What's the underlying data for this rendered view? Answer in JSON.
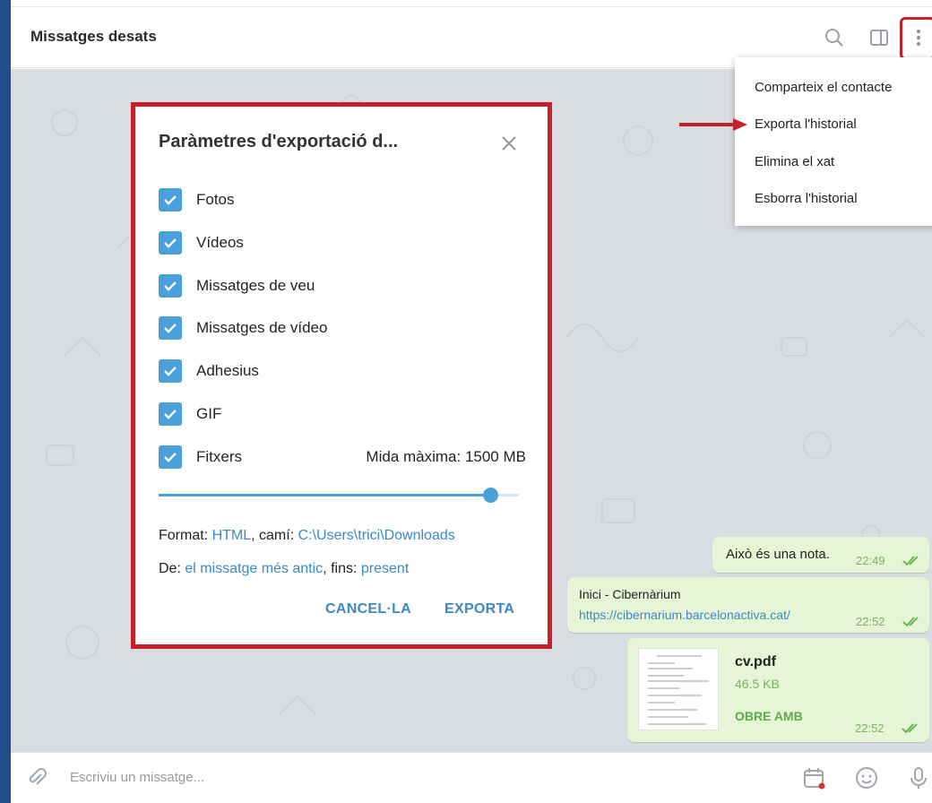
{
  "header": {
    "title": "Missatges desats",
    "icons": [
      "search-icon",
      "sidebar-toggle-icon",
      "more-vertical-icon"
    ]
  },
  "menu": {
    "items": [
      {
        "label": "Comparteix el contacte"
      },
      {
        "label": "Exporta l'historial"
      },
      {
        "label": "Elimina el xat"
      },
      {
        "label": "Esborra l'historial"
      }
    ]
  },
  "dialog": {
    "title": "Paràmetres d'exportació d...",
    "options": [
      {
        "label": "Fotos",
        "checked": true
      },
      {
        "label": "Vídeos",
        "checked": true
      },
      {
        "label": "Missatges de veu",
        "checked": true
      },
      {
        "label": "Missatges de vídeo",
        "checked": true
      },
      {
        "label": "Adhesius",
        "checked": true
      },
      {
        "label": "GIF",
        "checked": true
      },
      {
        "label": "Fitxers",
        "checked": true
      }
    ],
    "max_size_label": "Mida màxima: 1500 MB",
    "slider_fraction": 0.92,
    "format_prefix": "Format: ",
    "format_value": "HTML",
    "path_prefix": ", camí: ",
    "path_value": "C:\\Users\\trici\\Downloads",
    "from_prefix": "De: ",
    "from_value": "el missatge més antic",
    "to_prefix": ", fins: ",
    "to_value": "present",
    "cancel_label": "CANCEL·LA",
    "export_label": "EXPORTA"
  },
  "messages": [
    {
      "text": "Això és una nota.",
      "time": "22:49"
    },
    {
      "title": "Inici - Cibernàrium",
      "link": "https://cibernarium.barcelonactiva.cat/",
      "time": "22:52"
    },
    {
      "file_name": "cv.pdf",
      "file_size": "46.5 KB",
      "action": "OBRE AMB",
      "time": "22:52"
    }
  ],
  "composer": {
    "placeholder": "Escriviu un missatge..."
  },
  "colors": {
    "accent": "#3a88c7",
    "checkbox": "#4aa0da",
    "highlight": "#c8202a",
    "bubble": "#e6f5d6"
  }
}
